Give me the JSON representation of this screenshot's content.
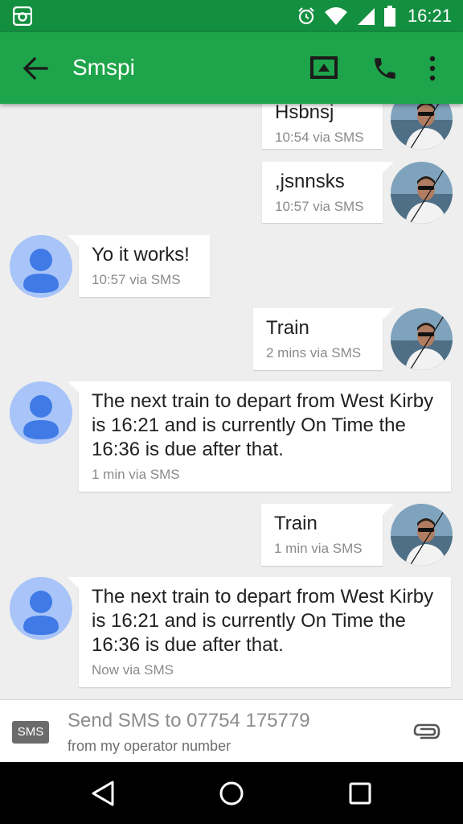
{
  "status_bar": {
    "time": "16:21",
    "icons": [
      "instagram-icon",
      "alarm-icon",
      "wifi-icon",
      "signal-icon",
      "battery-icon"
    ]
  },
  "app_bar": {
    "title": "Smspi",
    "icons": [
      "back-arrow-icon",
      "video-call-icon",
      "phone-icon",
      "more-vert-icon"
    ]
  },
  "messages": [
    {
      "direction": "outgoing",
      "text": "Hsbnsj",
      "meta": "10:54 via SMS"
    },
    {
      "direction": "outgoing",
      "text": ",jsnnsks",
      "meta": "10:57 via SMS"
    },
    {
      "direction": "incoming",
      "text": "Yo it works!",
      "meta": "10:57 via SMS"
    },
    {
      "direction": "outgoing",
      "text": "Train",
      "meta": "2 mins via SMS"
    },
    {
      "direction": "incoming",
      "text": "The next train to depart from West Kirby is 16:21 and is currently On Time the 16:36 is due after that.",
      "meta": "1 min via SMS"
    },
    {
      "direction": "outgoing",
      "text": "Train",
      "meta": "1 min via SMS"
    },
    {
      "direction": "incoming",
      "text": "The next train to depart from West Kirby is 16:21 and is currently On Time the 16:36 is due after that.",
      "meta": "Now via SMS"
    }
  ],
  "input": {
    "badge": "SMS",
    "placeholder": "Send SMS to 07754 175779",
    "subtext": "from my operator number",
    "attach_icon": "paperclip-icon"
  },
  "nav_bar": {
    "icons": [
      "back-triangle-icon",
      "home-circle-icon",
      "recents-square-icon"
    ]
  },
  "colors": {
    "status_bar": "#138f40",
    "app_bar": "#1ea44a",
    "background": "#eeeeee",
    "contact_avatar": "#a8c4f8",
    "contact_avatar_figure": "#3f7ae6"
  }
}
